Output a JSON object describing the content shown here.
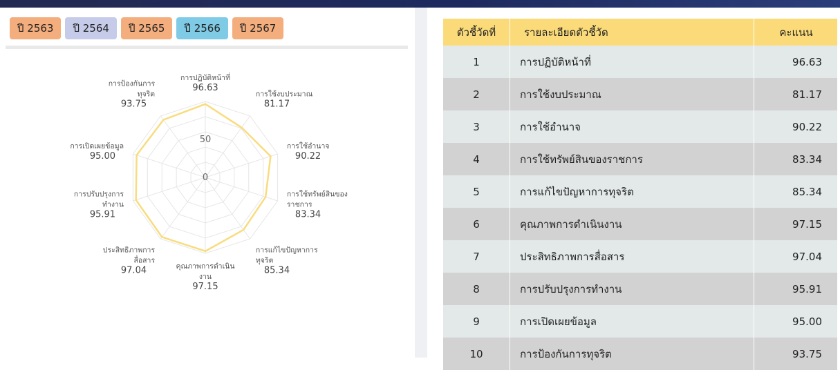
{
  "year_tabs": [
    {
      "label": "ปี 2563",
      "color": "#f4ad7d"
    },
    {
      "label": "ปี 2564",
      "color": "#c5cbe9"
    },
    {
      "label": "ปี 2565",
      "color": "#f4ad7d"
    },
    {
      "label": "ปี 2566",
      "color": "#7fcbe6"
    },
    {
      "label": "ปี 2567",
      "color": "#f4ad7d"
    }
  ],
  "table": {
    "headers": {
      "no": "ตัวชี้วัดที่",
      "desc": "รายละเอียดตัวชี้วัด",
      "score": "คะแนน"
    },
    "rows": [
      {
        "no": "1",
        "desc": "การปฏิบัติหน้าที่",
        "score": "96.63"
      },
      {
        "no": "2",
        "desc": "การใช้งบประมาณ",
        "score": "81.17"
      },
      {
        "no": "3",
        "desc": "การใช้อำนาจ",
        "score": "90.22"
      },
      {
        "no": "4",
        "desc": "การใช้ทรัพย์สินของราชการ",
        "score": "83.34"
      },
      {
        "no": "5",
        "desc": "การแก้ไขปัญหาการทุจริต",
        "score": "85.34"
      },
      {
        "no": "6",
        "desc": "คุณภาพการดำเนินงาน",
        "score": "97.15"
      },
      {
        "no": "7",
        "desc": "ประสิทธิภาพการสื่อสาร",
        "score": "97.04"
      },
      {
        "no": "8",
        "desc": "การปรับปรุงการทำงาน",
        "score": "95.91"
      },
      {
        "no": "9",
        "desc": "การเปิดเผยข้อมูล",
        "score": "95.00"
      },
      {
        "no": "10",
        "desc": "การป้องกันการทุจริต",
        "score": "93.75"
      }
    ]
  },
  "chart_data": {
    "type": "radar",
    "categories": [
      "การปฏิบัติหน้าที่",
      "การใช้งบประมาณ",
      "การใช้อำนาจ",
      "การใช้ทรัพย์สินของราชการ",
      "การแก้ไขปัญหาการทุจริต",
      "คุณภาพการดำเนินงาน",
      "ประสิทธิภาพการสื่อสาร",
      "การปรับปรุงการทำงาน",
      "การเปิดเผยข้อมูล",
      "การป้องกันการทุจริต"
    ],
    "label_lines": [
      [
        "การปฏิบัติหน้าที่"
      ],
      [
        "การใช้งบประมาณ"
      ],
      [
        "การใช้อำนาจ"
      ],
      [
        "การใช้ทรัพย์สินของ",
        "ราชการ"
      ],
      [
        "การแก้ไขปัญหาการ",
        "ทุจริต"
      ],
      [
        "คุณภาพการดำเนิน",
        "งาน"
      ],
      [
        "ประสิทธิภาพการ",
        "สื่อสาร"
      ],
      [
        "การปรับปรุงการ",
        "ทำงาน"
      ],
      [
        "การเปิดเผยข้อมูล"
      ],
      [
        "การป้องกันการ",
        "ทุจริต"
      ]
    ],
    "values": [
      96.63,
      81.17,
      90.22,
      83.34,
      85.34,
      97.15,
      97.04,
      95.91,
      95.0,
      93.75
    ],
    "value_labels": [
      "96.63",
      "81.17",
      "90.22",
      "83.34",
      "85.34",
      "97.15",
      "97.04",
      "95.91",
      "95.00",
      "93.75"
    ],
    "range": [
      0,
      100
    ],
    "ticks": [
      0,
      50
    ],
    "grid": true,
    "series_color": "#f9dc7e"
  }
}
